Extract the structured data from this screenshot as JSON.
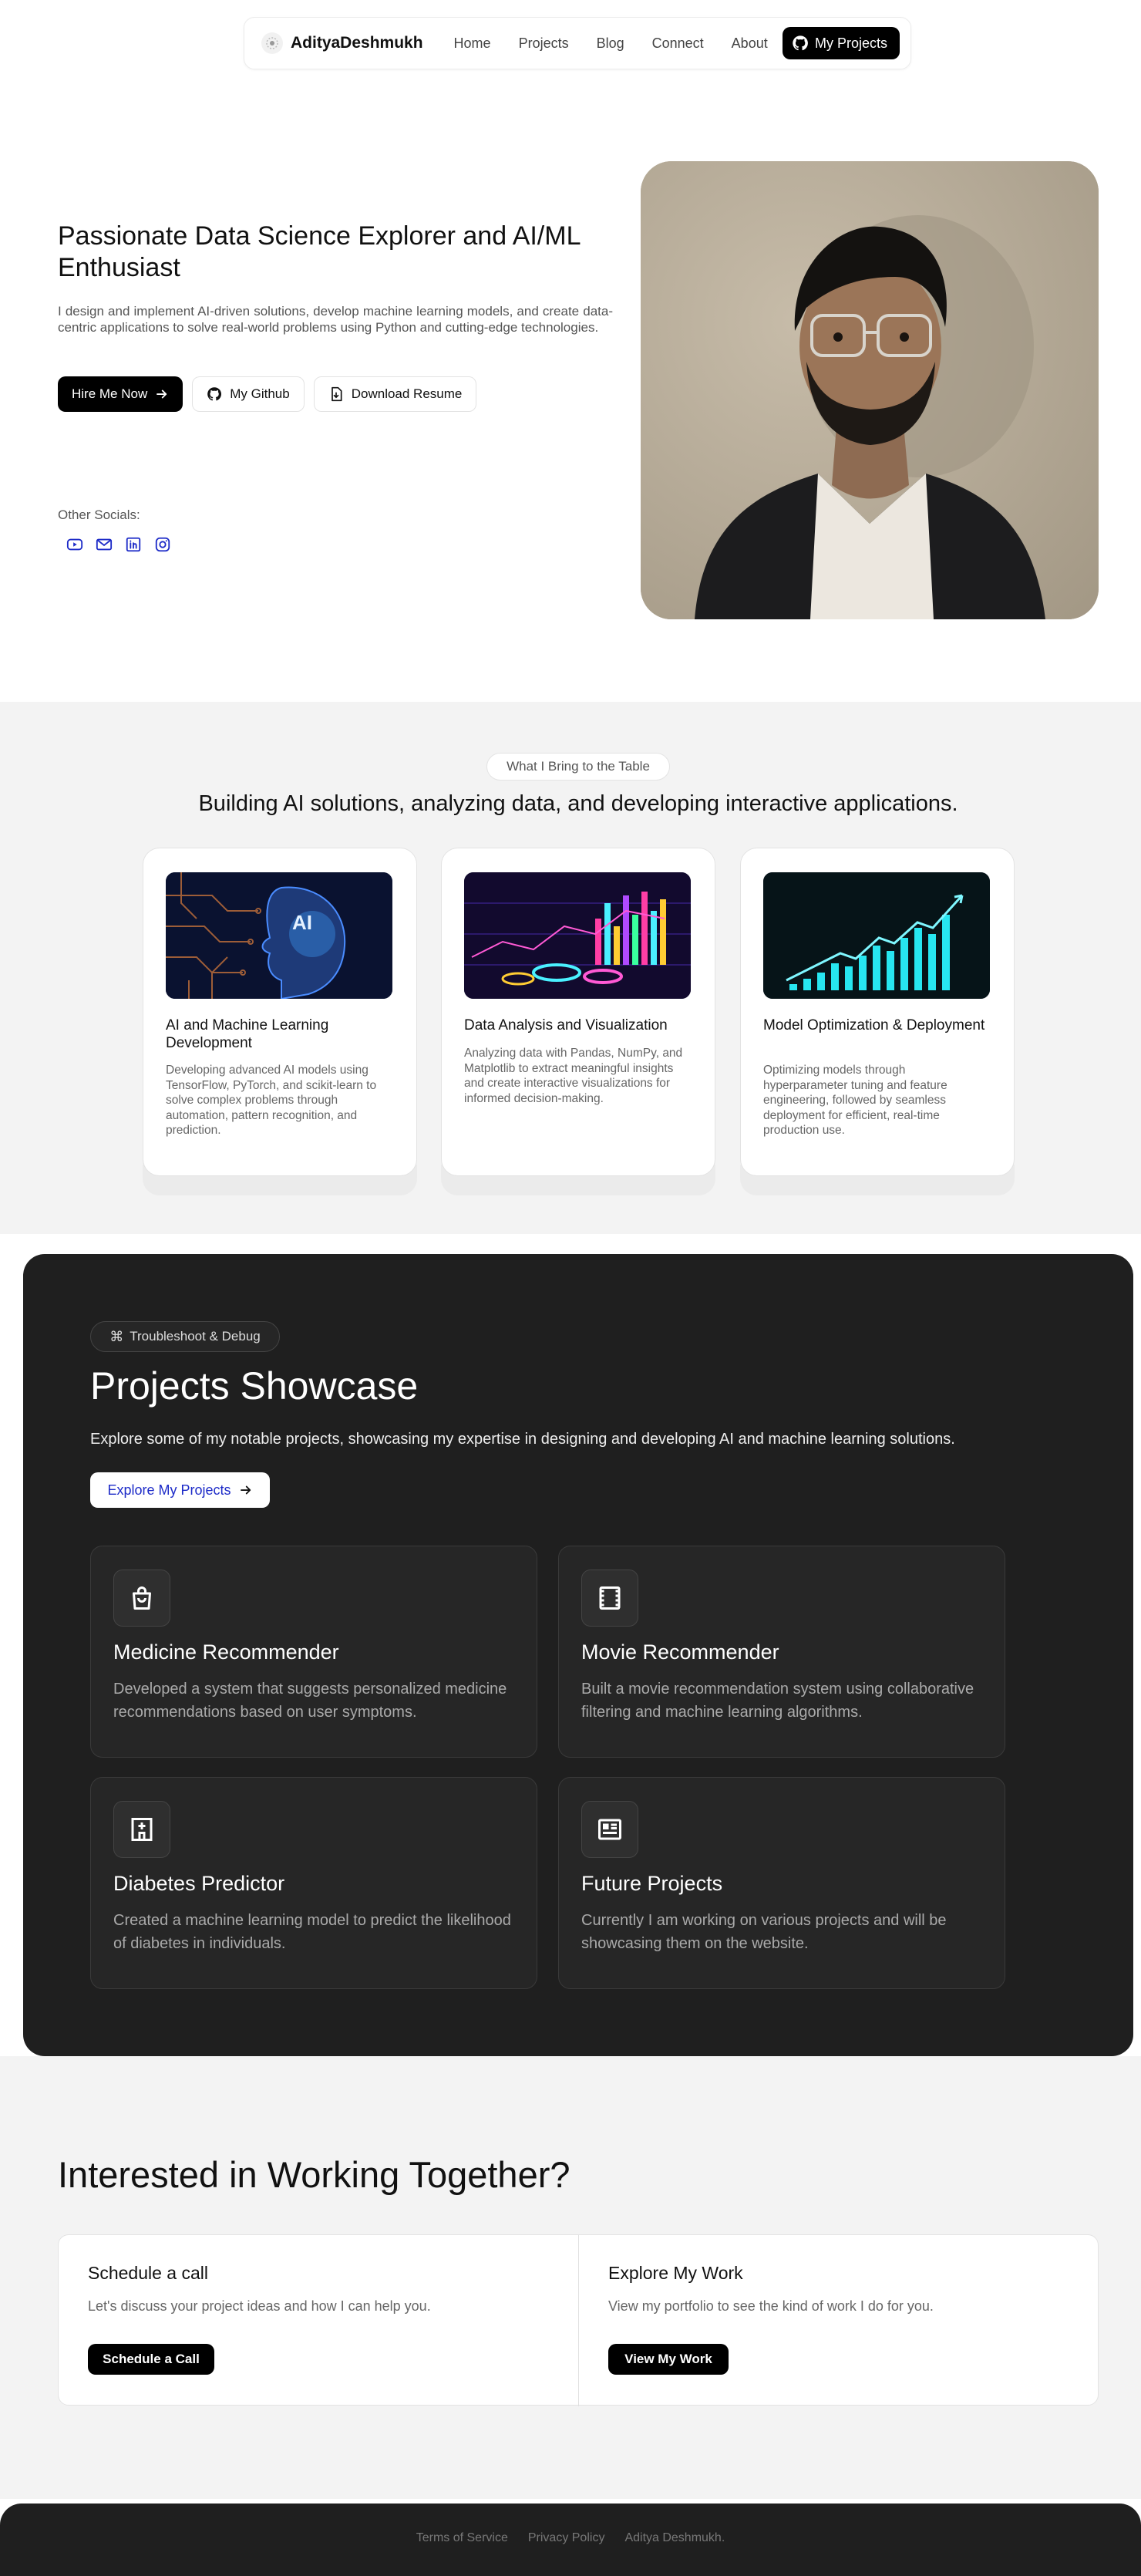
{
  "nav": {
    "brand": "AdityaDeshmukh",
    "links": [
      "Home",
      "Projects",
      "Blog",
      "Connect",
      "About"
    ],
    "cta": "My Projects"
  },
  "hero": {
    "title": "Passionate Data Science Explorer and AI/ML Enthusiast",
    "description": "I design and implement AI-driven solutions, develop machine learning models, and create data-centric applications to solve real-world problems using Python and cutting-edge technologies.",
    "buttons": {
      "hire": "Hire Me Now",
      "github": "My Github",
      "resume": "Download Resume"
    },
    "socials_label": "Other Socials:",
    "socials": [
      "youtube-icon",
      "mail-icon",
      "linkedin-icon",
      "instagram-icon"
    ]
  },
  "services": {
    "pill": "What I Bring to the Table",
    "heading": "Building AI solutions, analyzing data, and developing interactive applications.",
    "cards": [
      {
        "title": "AI and Machine Learning Development",
        "text": "Developing advanced AI models using TensorFlow, PyTorch, and scikit-learn to solve complex problems through automation, pattern recognition, and prediction.",
        "image_text": "AI"
      },
      {
        "title": "Data Analysis and Visualization",
        "text": "Analyzing data with Pandas, NumPy, and Matplotlib to extract meaningful insights and create interactive visualizations for informed decision-making."
      },
      {
        "title": "Model Optimization & Deployment",
        "text": "Optimizing models through hyperparameter tuning and feature engineering, followed by seamless deployment for efficient, real-time production use."
      }
    ]
  },
  "projects": {
    "pill": "Troubleshoot & Debug",
    "title": "Projects Showcase",
    "description": "Explore some of my notable projects, showcasing my expertise in designing and developing AI and machine learning solutions.",
    "button": "Explore My Projects",
    "items": [
      {
        "title": "Medicine Recommender",
        "text": "Developed a system that suggests personalized medicine recommendations based on user symptoms.",
        "icon": "shopping-bag-icon"
      },
      {
        "title": "Movie Recommender",
        "text": "Built a movie recommendation system using collaborative filtering and machine learning algorithms.",
        "icon": "film-icon"
      },
      {
        "title": "Diabetes Predictor",
        "text": "Created a machine learning model to predict the likelihood of diabetes in individuals.",
        "icon": "hospital-icon"
      },
      {
        "title": "Future Projects",
        "text": "Currently I am working on various projects and will be showcasing them on the website.",
        "icon": "newspaper-icon"
      }
    ]
  },
  "contact": {
    "title": "Interested in Working Together?",
    "columns": [
      {
        "title": "Schedule a call",
        "text": "Let's discuss your project ideas and how I can help you.",
        "button": "Schedule a Call"
      },
      {
        "title": "Explore My Work",
        "text": "View my portfolio to see the kind of work I do for you.",
        "button": "View My Work"
      }
    ]
  },
  "footer": {
    "links": [
      "Terms of Service",
      "Privacy Policy",
      "Aditya Deshmukh."
    ]
  },
  "colors": {
    "accent": "#1d2bc8",
    "dark": "#1f1f1f",
    "section_bg": "#f3f3f3"
  }
}
